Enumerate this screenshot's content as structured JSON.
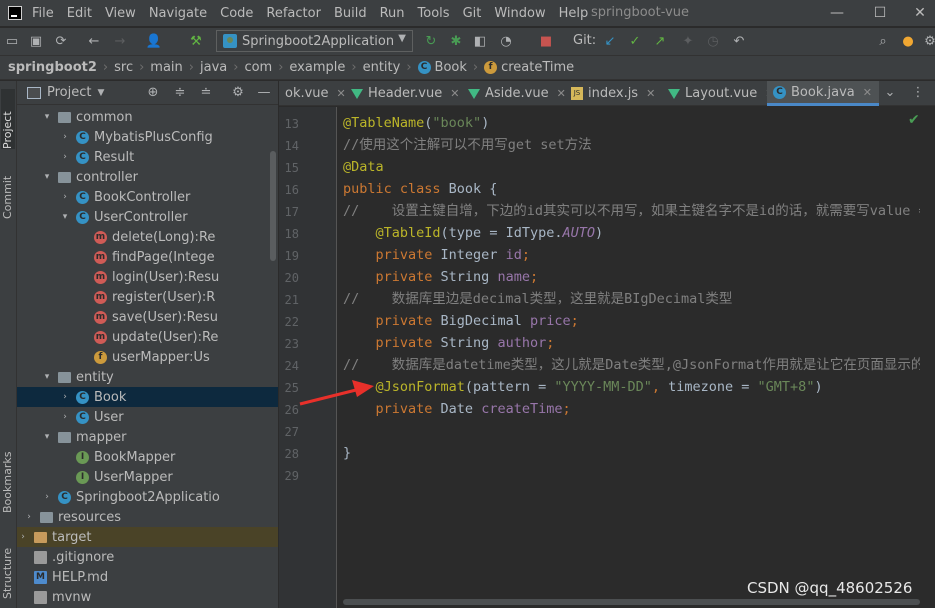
{
  "menubar": {
    "items": [
      "File",
      "Edit",
      "View",
      "Navigate",
      "Code",
      "Refactor",
      "Build",
      "Run",
      "Tools",
      "Git",
      "Window",
      "Help"
    ],
    "title": "springboot-vue",
    "minimize": "—",
    "maximize": "☐",
    "close": "✕"
  },
  "toolbar": {
    "run_config": "Springboot2Application",
    "git_label": "Git:"
  },
  "breadcrumb": [
    "springboot2",
    "src",
    "main",
    "java",
    "com",
    "example",
    "entity",
    "Book",
    "createTime"
  ],
  "stripe": {
    "project": "Project",
    "commit": "Commit",
    "bookmarks": "Bookmarks",
    "structure": "Structure"
  },
  "project_panel": {
    "title": "Project",
    "tree": [
      {
        "label": "common",
        "indent": 4,
        "icon": "folder",
        "arrow": "▾"
      },
      {
        "label": "MybatisPlusConfig",
        "indent": 5,
        "icon": "class",
        "arrow": "›"
      },
      {
        "label": "Result",
        "indent": 5,
        "icon": "class",
        "arrow": "›"
      },
      {
        "label": "controller",
        "indent": 4,
        "icon": "folder",
        "arrow": "▾"
      },
      {
        "label": "BookController",
        "indent": 5,
        "icon": "class",
        "arrow": "›"
      },
      {
        "label": "UserController",
        "indent": 5,
        "icon": "class",
        "arrow": "▾"
      },
      {
        "label": "delete(Long):Re",
        "indent": 6,
        "icon": "method",
        "arrow": ""
      },
      {
        "label": "findPage(Intege",
        "indent": 6,
        "icon": "method",
        "arrow": ""
      },
      {
        "label": "login(User):Resu",
        "indent": 6,
        "icon": "method",
        "arrow": ""
      },
      {
        "label": "register(User):R",
        "indent": 6,
        "icon": "method",
        "arrow": ""
      },
      {
        "label": "save(User):Resu",
        "indent": 6,
        "icon": "method",
        "arrow": ""
      },
      {
        "label": "update(User):Re",
        "indent": 6,
        "icon": "method",
        "arrow": ""
      },
      {
        "label": "userMapper:Us",
        "indent": 6,
        "icon": "field",
        "arrow": ""
      },
      {
        "label": "entity",
        "indent": 4,
        "icon": "folder",
        "arrow": "▾"
      },
      {
        "label": "Book",
        "indent": 5,
        "icon": "class",
        "arrow": "›",
        "selected": true
      },
      {
        "label": "User",
        "indent": 5,
        "icon": "class",
        "arrow": "›"
      },
      {
        "label": "mapper",
        "indent": 4,
        "icon": "folder",
        "arrow": "▾"
      },
      {
        "label": "BookMapper",
        "indent": 5,
        "icon": "iface",
        "arrow": ""
      },
      {
        "label": "UserMapper",
        "indent": 5,
        "icon": "iface",
        "arrow": ""
      },
      {
        "label": "Springboot2Applicatio",
        "indent": 4,
        "icon": "class",
        "arrow": "›"
      },
      {
        "label": "resources",
        "indent": 3,
        "icon": "folder",
        "arrow": "›"
      },
      {
        "label": "target",
        "indent": 1,
        "icon": "folder-target",
        "arrow": "›",
        "target": true
      },
      {
        "label": ".gitignore",
        "indent": 1,
        "icon": "file",
        "arrow": ""
      },
      {
        "label": "HELP.md",
        "indent": 1,
        "icon": "md",
        "arrow": ""
      },
      {
        "label": "mvnw",
        "indent": 1,
        "icon": "file",
        "arrow": ""
      }
    ]
  },
  "tabs": [
    {
      "label": "ok.vue",
      "type": "vue"
    },
    {
      "label": "Header.vue",
      "type": "vue"
    },
    {
      "label": "Aside.vue",
      "type": "vue"
    },
    {
      "label": "index.js",
      "type": "js"
    },
    {
      "label": "Layout.vue",
      "type": "vue"
    },
    {
      "label": "Book.java",
      "type": "java",
      "active": true
    }
  ],
  "editor": {
    "line_numbers": [
      13,
      14,
      15,
      16,
      17,
      18,
      19,
      20,
      21,
      22,
      23,
      24,
      25,
      26,
      27,
      28,
      29
    ],
    "lines": [
      {
        "parts": [
          [
            "an",
            "@TableName"
          ],
          [
            "",
            "("
          ],
          [
            "st",
            "\"book\""
          ],
          [
            "",
            ")"
          ]
        ]
      },
      {
        "parts": [
          [
            "cm",
            "//使用这个注解可以不用写get set方法"
          ]
        ]
      },
      {
        "parts": [
          [
            "an",
            "@Data"
          ]
        ]
      },
      {
        "parts": [
          [
            "kw",
            "public class "
          ],
          [
            "",
            "Book {"
          ]
        ]
      },
      {
        "parts": [
          [
            "cm",
            "//    设置主键自增，下边的id其实可以不用写，如果主键名字不是id的话，就需要写value =\"id\""
          ]
        ]
      },
      {
        "parts": [
          [
            "an",
            "    @TableId"
          ],
          [
            "",
            "(type = IdType."
          ],
          [
            "it",
            "AUTO"
          ],
          [
            "",
            ")"
          ]
        ]
      },
      {
        "parts": [
          [
            "kw",
            "    private "
          ],
          [
            "",
            "Integer "
          ],
          [
            "fd",
            "id"
          ],
          [
            "kw",
            ";"
          ]
        ]
      },
      {
        "parts": [
          [
            "kw",
            "    private "
          ],
          [
            "",
            "String "
          ],
          [
            "fd",
            "name"
          ],
          [
            "kw",
            ";"
          ]
        ]
      },
      {
        "parts": [
          [
            "cm",
            "//    数据库里边是decimal类型，这里就是BIgDecimal类型"
          ]
        ]
      },
      {
        "parts": [
          [
            "kw",
            "    private "
          ],
          [
            "",
            "BigDecimal "
          ],
          [
            "fd",
            "price"
          ],
          [
            "kw",
            ";"
          ]
        ]
      },
      {
        "parts": [
          [
            "kw",
            "    private "
          ],
          [
            "",
            "String "
          ],
          [
            "fd",
            "author"
          ],
          [
            "kw",
            ";"
          ]
        ]
      },
      {
        "parts": [
          [
            "cm",
            "//    数据库是datetime类型，这儿就是Date类型,@JsonFormat作用就是让它在页面显示的更加好看"
          ]
        ]
      },
      {
        "parts": [
          [
            "an",
            "    @JsonFormat"
          ],
          [
            "",
            "(pattern = "
          ],
          [
            "st",
            "\"YYYY-MM-DD\""
          ],
          [
            "kw",
            ", "
          ],
          [
            "",
            "timezone = "
          ],
          [
            "st",
            "\"GMT+8\""
          ],
          [
            "",
            ")"
          ]
        ]
      },
      {
        "parts": [
          [
            "kw",
            "    private "
          ],
          [
            "",
            "Date "
          ],
          [
            "fd",
            "createTime"
          ],
          [
            "kw",
            ";"
          ]
        ]
      },
      {
        "parts": []
      },
      {
        "parts": [
          [
            "",
            "}"
          ]
        ]
      },
      {
        "parts": []
      }
    ]
  },
  "watermark": "CSDN @qq_48602526",
  "colors": {
    "accent": "#4a88c7",
    "arrow": "#e8302a"
  }
}
